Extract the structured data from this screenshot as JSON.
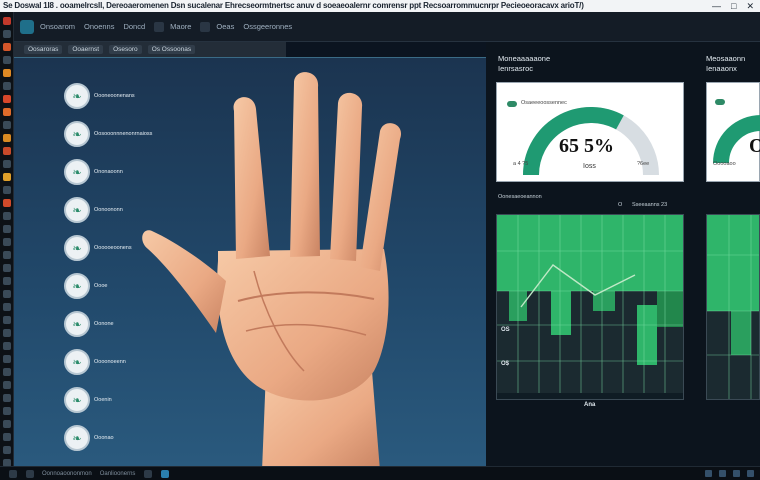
{
  "window": {
    "title": "Se Doswal 1I8 . ooamelrcsll, Dereoaeromenen Dsn sucalenar Ehrecseormtnertsc anuv d soeaeoalernr comrensr ppt Recsoarrommucnrpr Pecieoeoracavx arioT/)",
    "controls": [
      "—",
      "□",
      "✕"
    ]
  },
  "toolbar": {
    "menus": [
      "Onsoarom",
      "Onoenns",
      "Doncd",
      "Maore",
      "Oeas",
      "Ossgeeronnes"
    ],
    "tabs": [
      "Oosaroras",
      "Ooaernst",
      "Osesoro",
      "Os Ossoonas"
    ]
  },
  "list_items": [
    {
      "label": "Oooneoonenans",
      "icon": "leaf-icon"
    },
    {
      "label": "Oosooonnnenonrnaioss",
      "icon": "leaf-icon"
    },
    {
      "label": "Ononaoonn",
      "icon": "leaf-icon"
    },
    {
      "label": "Oonoononn",
      "icon": "leaf-icon"
    },
    {
      "label": "Oooooeoonens",
      "icon": "leaf-icon"
    },
    {
      "label": "Oooe",
      "icon": "leaf-icon"
    },
    {
      "label": "Oonone",
      "icon": "leaf-icon"
    },
    {
      "label": "Oooonoeenn",
      "icon": "leaf-icon"
    },
    {
      "label": "Ooenin",
      "icon": "leaf-icon"
    },
    {
      "label": "Ooonao",
      "icon": "leaf-icon"
    }
  ],
  "panel1": {
    "title": "Moneaaaaaone",
    "subtitle": "Ienrsasroc",
    "gauge_value": "65 5%",
    "gauge_sub": "Ioss",
    "gauge_left_small": "a 4 ?5",
    "gauge_right_small": "?6ee",
    "gauge_top_small": "Osaeeeoossennec",
    "gauge_fraction": 0.66,
    "chart_header_left": "Oonesaeoeannon",
    "chart_header_mid": "O",
    "chart_header_right": "Sseeaanns  23",
    "row_labels": [
      "OS",
      "O$"
    ],
    "x_label": "Ana"
  },
  "panel2": {
    "title": "Meosaaonn",
    "subtitle": "Ienaaonx",
    "gauge_value": "O",
    "gauge_small": "Ooooaoo"
  },
  "taskbar": {
    "labels": [
      "Oonnoaoononmon",
      "Oanlioonerns"
    ]
  },
  "colors": {
    "accent": "#1f9a72",
    "green_bright": "#37c46e",
    "canvas_top": "#1b3450",
    "canvas_bottom": "#2a5a7e"
  }
}
